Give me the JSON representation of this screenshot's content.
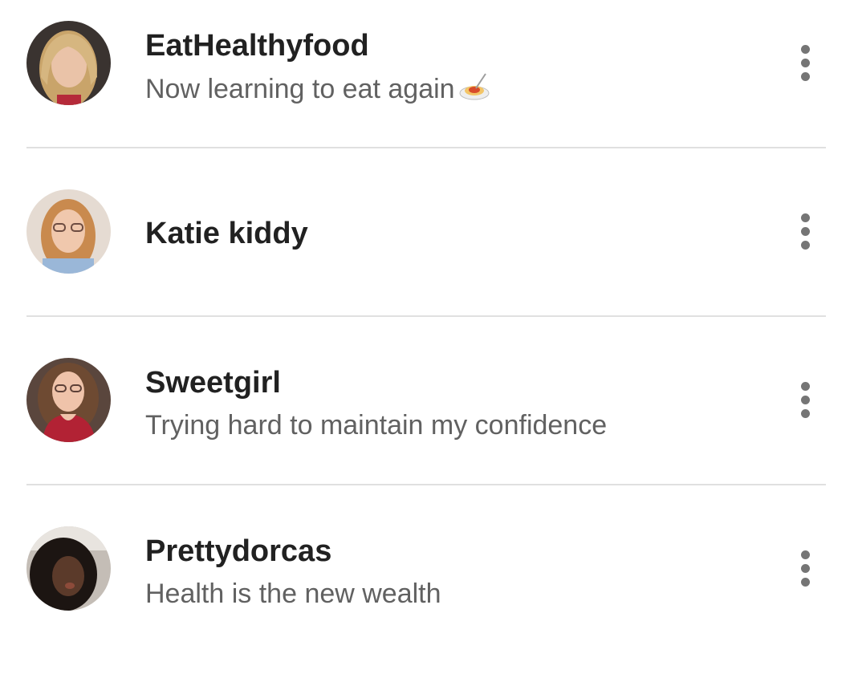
{
  "contacts": [
    {
      "name": "EatHealthyfood",
      "status": "Now learning to eat again",
      "status_emoji": "spaghetti-emoji",
      "avatar": "avatar-photo-blonde-woman"
    },
    {
      "name": "Katie kiddy",
      "status": "",
      "avatar": "avatar-photo-woman-glasses"
    },
    {
      "name": "Sweetgirl",
      "status": "Trying hard to maintain my confidence",
      "avatar": "avatar-photo-woman-curly-hair"
    },
    {
      "name": "Prettydorcas",
      "status": "Health is the new wealth",
      "avatar": "avatar-photo-woman-dark-curly-hair"
    }
  ],
  "icons": {
    "menu": "more-vertical-icon"
  },
  "colors": {
    "name_text": "#212121",
    "status_text": "#616161",
    "divider": "#e0e0e0",
    "menu_dots": "#757575"
  }
}
